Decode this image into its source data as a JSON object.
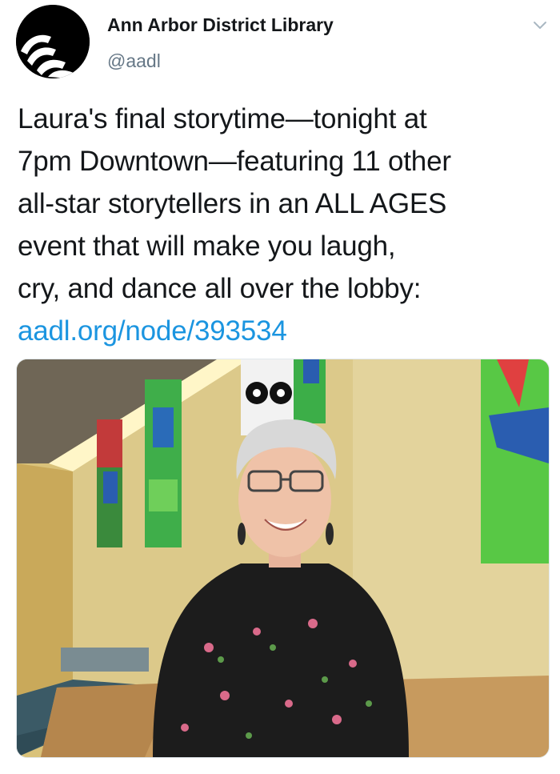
{
  "author": {
    "name": "Ann Arbor District Library",
    "handle": "@aadl"
  },
  "icons": {
    "avatar": "aadl-logo-icon",
    "menu": "chevron-down-icon"
  },
  "tweet": {
    "lines": [
      "Laura's final storytime—tonight at",
      "7pm Downtown—featuring 11 other",
      "all-star storytellers in an ALL AGES",
      "event that will make you laugh,",
      "cry, and dance all over the lobby:"
    ],
    "link": "aadl.org/node/393534"
  },
  "colors": {
    "link": "#1b95e0",
    "name": "#14171a",
    "handle": "#657786",
    "caret": "#aab8c2"
  }
}
